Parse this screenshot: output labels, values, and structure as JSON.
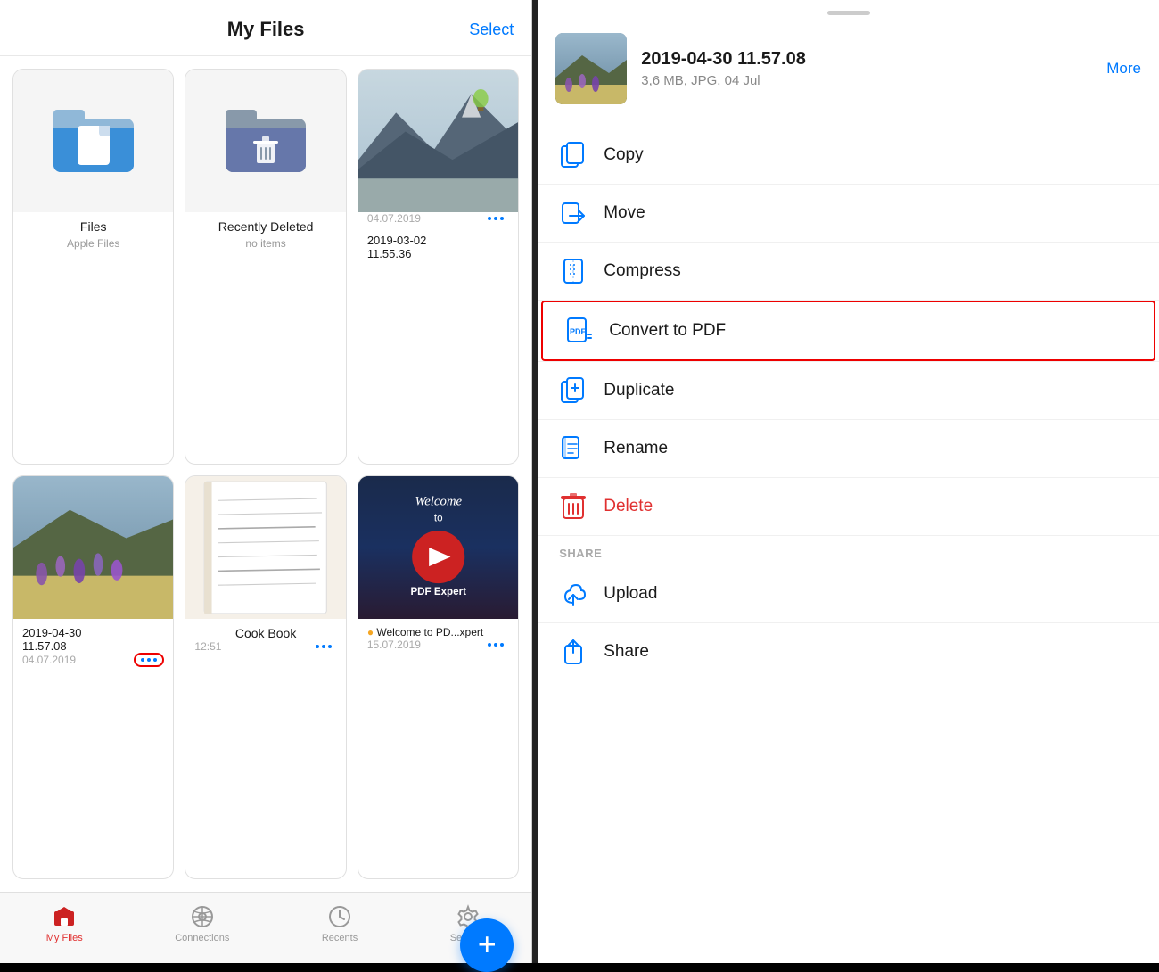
{
  "left": {
    "title": "My Files",
    "select_label": "Select",
    "files": [
      {
        "id": "files",
        "name": "Files",
        "sub": "Apple Files",
        "type": "folder-blue",
        "date": "",
        "show_dots": false,
        "highlighted_dots": false
      },
      {
        "id": "recently-deleted",
        "name": "Recently Deleted",
        "sub": "no items",
        "type": "folder-trash",
        "date": "",
        "show_dots": false,
        "highlighted_dots": false
      },
      {
        "id": "photo1",
        "name": "2019-03-02 11.55.36",
        "sub": "",
        "type": "photo-landscape",
        "date": "04.07.2019",
        "show_dots": true,
        "highlighted_dots": false
      },
      {
        "id": "photo2",
        "name": "2019-04-30 11.57.08",
        "sub": "",
        "type": "photo-flowers",
        "date": "04.07.2019",
        "show_dots": true,
        "highlighted_dots": true
      },
      {
        "id": "cookbook",
        "name": "Cook Book",
        "sub": "",
        "type": "notebook",
        "date": "12:51",
        "show_dots": true,
        "highlighted_dots": false
      },
      {
        "id": "pdfexpert",
        "name": "● Welcome to PD...xpert",
        "sub": "",
        "type": "pdf-expert",
        "date": "15.07.2019",
        "show_dots": true,
        "highlighted_dots": false
      }
    ],
    "nav": [
      {
        "id": "my-files",
        "label": "My Files",
        "active": true
      },
      {
        "id": "connections",
        "label": "Connections",
        "active": false
      },
      {
        "id": "recents",
        "label": "Recents",
        "active": false
      },
      {
        "id": "settings",
        "label": "Settings",
        "active": false
      }
    ],
    "fab_label": "+"
  },
  "right": {
    "file_name": "2019-04-30 11.57.08",
    "file_info": "3,6 MB, JPG, 04 Jul",
    "more_label": "More",
    "menu_items": [
      {
        "id": "copy",
        "label": "Copy",
        "icon": "copy",
        "color": "blue",
        "highlighted": false
      },
      {
        "id": "move",
        "label": "Move",
        "icon": "move",
        "color": "blue",
        "highlighted": false
      },
      {
        "id": "compress",
        "label": "Compress",
        "icon": "compress",
        "color": "blue",
        "highlighted": false
      },
      {
        "id": "convert-to-pdf",
        "label": "Convert to PDF",
        "icon": "pdf",
        "color": "blue",
        "highlighted": true
      },
      {
        "id": "duplicate",
        "label": "Duplicate",
        "icon": "duplicate",
        "color": "blue",
        "highlighted": false
      },
      {
        "id": "rename",
        "label": "Rename",
        "icon": "rename",
        "color": "blue",
        "highlighted": false
      },
      {
        "id": "delete",
        "label": "Delete",
        "icon": "delete",
        "color": "red",
        "highlighted": false
      }
    ],
    "share_section": "SHARE",
    "share_items": [
      {
        "id": "upload",
        "label": "Upload",
        "icon": "upload",
        "color": "blue"
      },
      {
        "id": "share",
        "label": "Share",
        "icon": "share",
        "color": "blue"
      }
    ]
  }
}
